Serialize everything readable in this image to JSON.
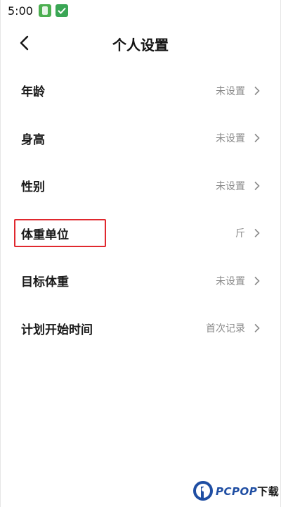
{
  "status_bar": {
    "time": "5:00",
    "icons": [
      "app-icon",
      "check-icon"
    ]
  },
  "header": {
    "title": "个人设置",
    "back_icon": "chevron-left-icon"
  },
  "settings": [
    {
      "label": "年龄",
      "value": "未设置"
    },
    {
      "label": "身高",
      "value": "未设置"
    },
    {
      "label": "性别",
      "value": "未设置"
    },
    {
      "label": "体重单位",
      "value": "斤"
    },
    {
      "label": "目标体重",
      "value": "未设置"
    },
    {
      "label": "计划开始时间",
      "value": "首次记录"
    }
  ],
  "highlight": {
    "target": "体重单位",
    "color": "#e0282e"
  },
  "watermark": {
    "text": "PCPOP",
    "suffix": "下载",
    "color": "#1f4ea3"
  },
  "colors": {
    "text_primary": "#1a1a1a",
    "text_secondary": "#8a8a8a",
    "background": "#ffffff"
  }
}
